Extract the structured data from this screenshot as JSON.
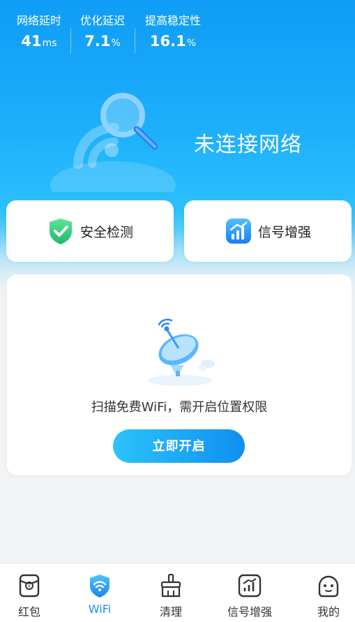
{
  "stats": [
    {
      "label": "网络延时",
      "value": "41",
      "unit": "ms"
    },
    {
      "label": "优化延迟",
      "value": "7.1",
      "unit": "%"
    },
    {
      "label": "提高稳定性",
      "value": "16.1",
      "unit": "%"
    }
  ],
  "status_text": "未连接网络",
  "features": [
    {
      "label": "安全检测",
      "icon": "shield-check-icon"
    },
    {
      "label": "信号增强",
      "icon": "signal-chart-icon"
    }
  ],
  "wifi_card": {
    "message": "扫描免费WiFi，需开启位置权限",
    "button_label": "立即开启"
  },
  "tabs": [
    {
      "label": "红包",
      "icon": "red-packet-icon",
      "active": false
    },
    {
      "label": "WiFi",
      "icon": "wifi-icon",
      "active": true
    },
    {
      "label": "清理",
      "icon": "broom-icon",
      "active": false
    },
    {
      "label": "信号增强",
      "icon": "signal-chart-icon",
      "active": false
    },
    {
      "label": "我的",
      "icon": "profile-face-icon",
      "active": false
    }
  ],
  "colors": {
    "primary": "#1296f3",
    "hero_top": "#0f9cf6",
    "shield_green": "#2fcf7f",
    "inactive_tab": "#333333"
  }
}
